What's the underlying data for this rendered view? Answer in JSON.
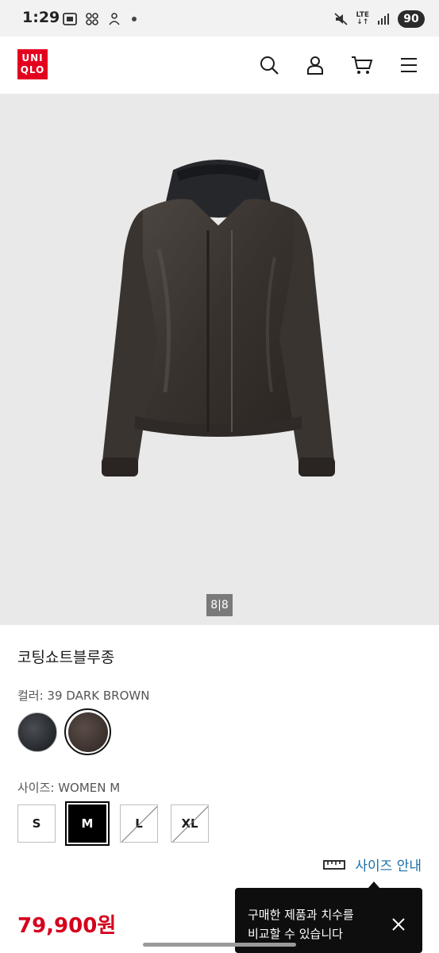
{
  "status_bar": {
    "time": "1:29",
    "network": "LTE",
    "battery": "90"
  },
  "header": {
    "logo_line1": "UNI",
    "logo_line2": "QLO",
    "brand_color": "#e4001f",
    "icons": [
      "search-icon",
      "account-icon",
      "cart-icon",
      "menu-icon"
    ]
  },
  "gallery": {
    "counter": "8|8"
  },
  "product": {
    "name": "코팅쇼트블루종",
    "color_label": "컬러: 39 DARK BROWN",
    "colors": [
      {
        "name": "dark gray",
        "hex": "#2f3236",
        "selected": false
      },
      {
        "name": "39 DARK BROWN",
        "hex": "#45393a",
        "selected": true
      }
    ],
    "size_label": "사이즈: WOMEN M",
    "sizes": [
      {
        "label": "S",
        "state": "available"
      },
      {
        "label": "M",
        "state": "selected"
      },
      {
        "label": "L",
        "state": "unavailable"
      },
      {
        "label": "XL",
        "state": "unavailable"
      }
    ],
    "size_guide": "사이즈 안내",
    "price": "79,900원",
    "price_color": "#d4001c"
  },
  "tooltip": {
    "line1": "구매한 제품과 치수를",
    "line2": "비교할 수 있습니다"
  }
}
